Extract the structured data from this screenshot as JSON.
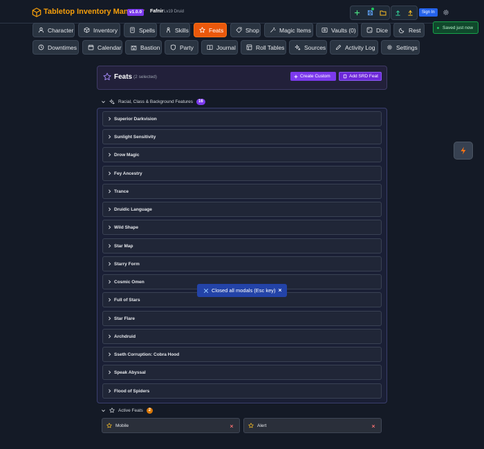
{
  "app": {
    "title": "Tabletop Inventory Manager",
    "version": "v1.0.0",
    "character_name": "Fafnir",
    "character_class": "Lv19 Druid",
    "sign_in": "Sign In"
  },
  "nav": {
    "row1": [
      {
        "label": "Character",
        "icon": "user-icon"
      },
      {
        "label": "Inventory",
        "icon": "box-icon"
      },
      {
        "label": "Spells",
        "icon": "book-icon"
      },
      {
        "label": "Skills",
        "icon": "skills-icon"
      },
      {
        "label": "Feats",
        "icon": "star-icon",
        "active": true
      },
      {
        "label": "Shop",
        "icon": "tag-icon"
      },
      {
        "label": "Magic Items",
        "icon": "wand-icon"
      },
      {
        "label": "Vaults (0)",
        "icon": "vault-icon"
      },
      {
        "label": "Dice",
        "icon": "dice-icon"
      },
      {
        "label": "Rest",
        "icon": "moon-icon"
      }
    ],
    "row2": [
      {
        "label": "Downtimes",
        "icon": "clock-icon"
      },
      {
        "label": "Calendar",
        "icon": "calendar-icon"
      },
      {
        "label": "Bastion",
        "icon": "castle-icon"
      },
      {
        "label": "Party",
        "icon": "shield-icon"
      },
      {
        "label": "Journal",
        "icon": "journal-icon"
      },
      {
        "label": "Roll Tables",
        "icon": "table-icon"
      },
      {
        "label": "Sources",
        "icon": "sparkle-icon"
      },
      {
        "label": "Activity Log",
        "icon": "pencil-icon"
      },
      {
        "label": "Settings",
        "icon": "gear-icon"
      }
    ]
  },
  "toast_saved": "Saved just now",
  "feats_panel": {
    "title": "Feats",
    "selected_count": "(2 selected)",
    "create_custom": "Create Custom",
    "add_srd": "Add SRD Feat"
  },
  "features_section": {
    "title": "Racial, Class & Background Features",
    "count": "16",
    "items": [
      "Superior Darkvision",
      "Sunlight Sensitivity",
      "Drow Magic",
      "Fey Ancestry",
      "Trance",
      "Druidic Language",
      "Wild Shape",
      "Star Map",
      "Starry Form",
      "Cosmic Omen",
      "Full of Stars",
      "Star Flare",
      "Archdruid",
      "Sseth Corruption: Cobra Hood",
      "Speak Abyssal",
      "Flood of Spiders"
    ]
  },
  "modal_toast": "Closed all modals (Esc key)",
  "active_feats": {
    "title": "Active Feats",
    "count": "2",
    "items": [
      "Mobile",
      "Alert"
    ]
  },
  "colors": {
    "accent_orange": "#ea580c",
    "purple": "#7c3aed",
    "gold": "#f59e0b",
    "blue": "#2563eb",
    "green": "#22c55e"
  }
}
